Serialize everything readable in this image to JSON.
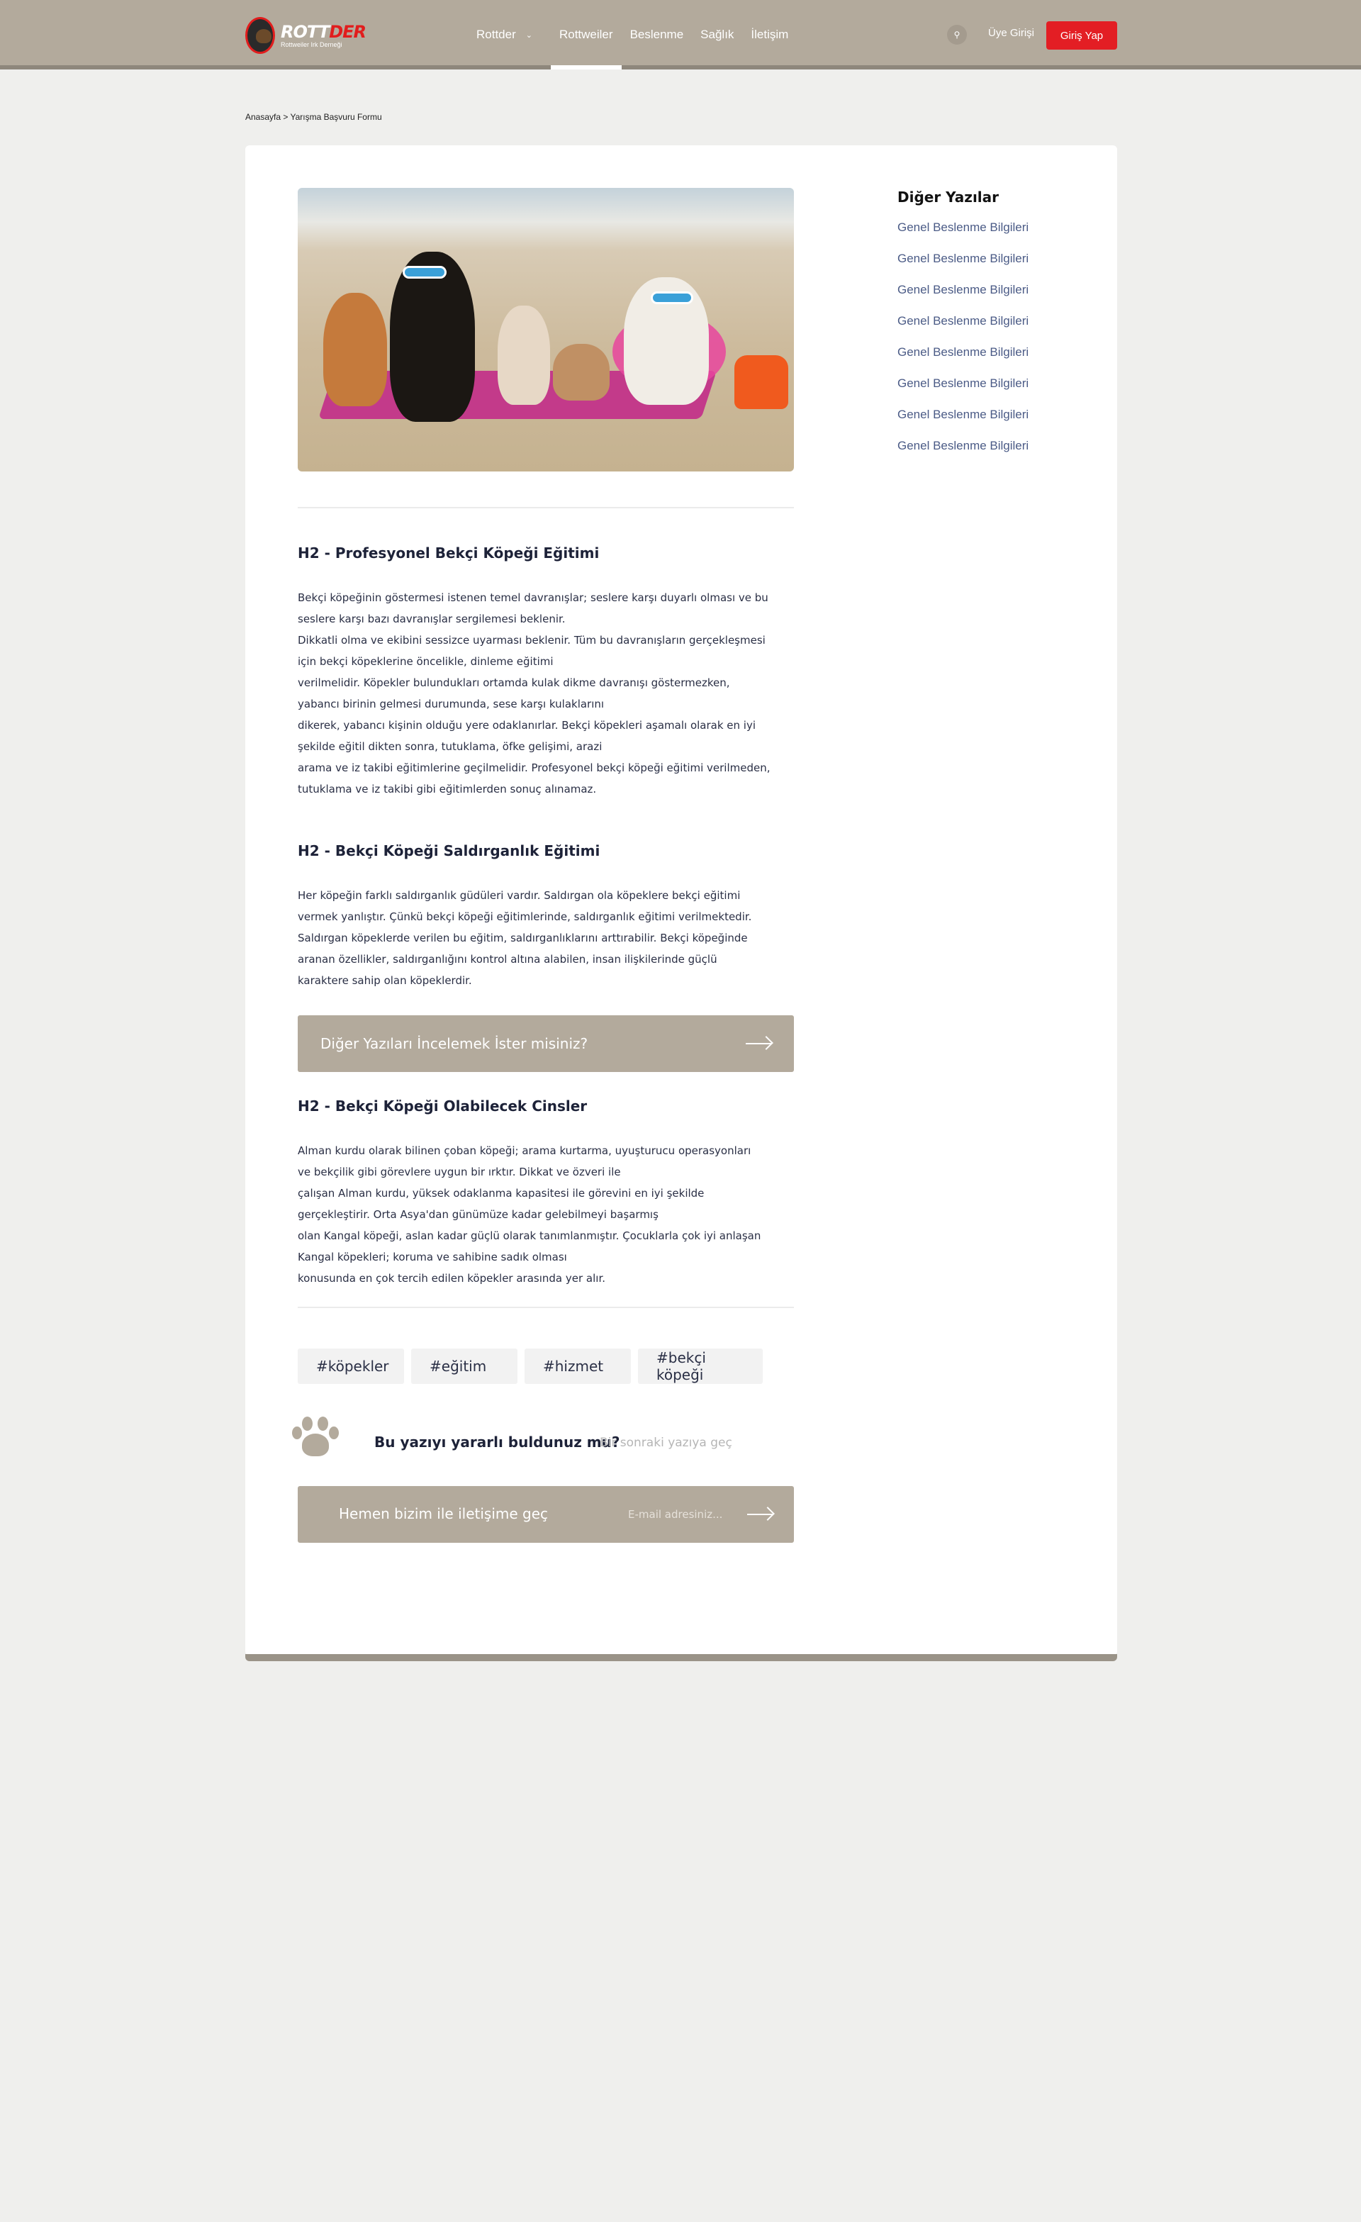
{
  "header": {
    "logo_word_1": "ROTT",
    "logo_word_2": "DER",
    "logo_sub": "Rottweiler Irk Derneği",
    "nav": [
      "Rottder",
      "Rottweiler",
      "Beslenme",
      "Sağlık",
      "İletişim"
    ],
    "member_login": "Üye Girişi",
    "login_button": "Giriş Yap"
  },
  "breadcrumb": "Anasayfa > Yarışma Başvuru Formu",
  "sections": [
    {
      "title": "H2 - Profesyonel Bekçi Köpeği Eğitimi",
      "lines": [
        "Bekçi köpeğinin göstermesi istenen temel davranışlar; seslere karşı duyarlı olması ve bu",
        "seslere karşı bazı davranışlar sergilemesi beklenir.",
        "Dikkatli olma ve ekibini sessizce uyarması beklenir. Tüm bu davranışların gerçekleşmesi",
        "için bekçi köpeklerine öncelikle, dinleme eğitimi",
        "verilmelidir. Köpekler bulundukları ortamda kulak dikme davranışı göstermezken,",
        "yabancı birinin gelmesi durumunda, sese karşı kulaklarını",
        "dikerek, yabancı kişinin olduğu yere odaklanırlar. Bekçi köpekleri aşamalı olarak en iyi",
        "şekilde eğitil dikten sonra, tutuklama, öfke gelişimi, arazi",
        "arama ve iz takibi eğitimlerine geçilmelidir. Profesyonel bekçi köpeği eğitimi verilmeden,",
        "tutuklama ve iz takibi gibi eğitimlerden sonuç alınamaz."
      ]
    },
    {
      "title": "H2 - Bekçi Köpeği Saldırganlık Eğitimi",
      "lines": [
        "Her köpeğin farklı saldırganlık güdüleri vardır. Saldırgan ola köpeklere bekçi eğitimi",
        "vermek yanlıştır. Çünkü bekçi köpeği eğitimlerinde, saldırganlık eğitimi verilmektedir.",
        "Saldırgan köpeklerde verilen bu eğitim, saldırganlıklarını arttırabilir. Bekçi köpeğinde",
        "aranan özellikler, saldırganlığını kontrol altına alabilen, insan ilişkilerinde güçlü",
        "karaktere sahip olan köpeklerdir."
      ]
    },
    {
      "title": "H2 - Bekçi Köpeği Olabilecek Cinsler",
      "lines": [
        "Alman kurdu olarak bilinen çoban köpeği; arama kurtarma, uyuşturucu operasyonları",
        "ve bekçilik gibi görevlere uygun bir ırktır. Dikkat ve özveri ile",
        "çalışan Alman kurdu, yüksek odaklanma kapasitesi ile görevini en iyi şekilde",
        "gerçekleştirir. Orta Asya'dan günümüze kadar gelebilmeyi başarmış",
        "olan Kangal köpeği, aslan kadar güçlü olarak tanımlanmıştır. Çocuklarla çok iyi anlaşan",
        "Kangal köpekleri; koruma ve sahibine sadık olması",
        "konusunda en çok tercih edilen köpekler arasında yer alır."
      ]
    }
  ],
  "cta": {
    "text": "Diğer Yazıları İncelemek İster misiniz?"
  },
  "tags": [
    "#köpekler",
    "#eğitim",
    "#hizmet",
    "#bekçi köpeği"
  ],
  "feedback": {
    "question": "Bu yazıyı yararlı buldunuz mu?",
    "next": "Bir sonraki yazıya geç"
  },
  "contact": {
    "text": "Hemen bizim ile iletişime geç",
    "email_placeholder": "E-mail adresiniz..."
  },
  "sidebar": {
    "title": "Diğer Yazılar",
    "links": [
      "Genel Beslenme Bilgileri",
      "Genel Beslenme Bilgileri",
      "Genel Beslenme Bilgileri",
      "Genel Beslenme Bilgileri",
      "Genel Beslenme Bilgileri",
      "Genel Beslenme Bilgileri",
      "Genel Beslenme Bilgileri",
      "Genel Beslenme Bilgileri"
    ]
  },
  "colors": {
    "header": "#b3aa9c",
    "accent": "#e31e24",
    "link": "#4b5b86"
  },
  "icons": [
    "logo-badge-icon",
    "chevron-down-icon",
    "search-icon",
    "arrow-right-icon",
    "paw-icon"
  ]
}
